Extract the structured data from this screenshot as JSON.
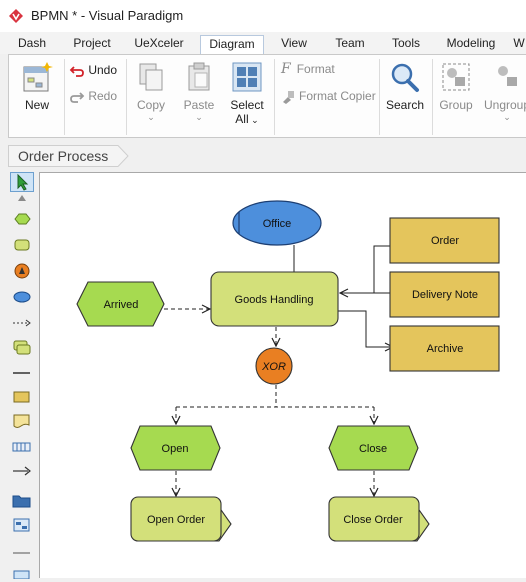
{
  "app": {
    "title": "BPMN * - Visual Paradigm"
  },
  "tabs": [
    {
      "label": "Dash"
    },
    {
      "label": "Project"
    },
    {
      "label": "UeXceler"
    },
    {
      "label": "Diagram",
      "active": true
    },
    {
      "label": "View"
    },
    {
      "label": "Team"
    },
    {
      "label": "Tools"
    },
    {
      "label": "Modeling"
    },
    {
      "label": "W"
    }
  ],
  "ribbon": {
    "new": "New",
    "undo": "Undo",
    "redo": "Redo",
    "copy": "Copy",
    "paste": "Paste",
    "select_all_line1": "Select",
    "select_all_line2": "All",
    "format": "Format",
    "format_copier": "Format Copier",
    "search": "Search",
    "group": "Group",
    "ungroup": "Ungroup"
  },
  "breadcrumb": {
    "label": "Order Process"
  },
  "toolbox": [
    "pointer-tool",
    "scroll-up-arrow",
    "event-tool",
    "task-tool",
    "gateway-tool",
    "data-object-tool",
    "connector-tool",
    "subprocess-tool",
    "line-tool",
    "note-tool",
    "document-tool",
    "pool-tool",
    "flow-arrow-tool",
    "folder-tool",
    "form-tool",
    "divider-tool"
  ],
  "diagram": {
    "office": "Office",
    "goods_handling": "Goods Handling",
    "arrived": "Arrived",
    "order": "Order",
    "delivery_note": "Delivery Note",
    "archive": "Archive",
    "xor": "XOR",
    "open": "Open",
    "close": "Close",
    "open_order": "Open Order",
    "close_order": "Close Order"
  },
  "colors": {
    "accent": "#b8c9de",
    "function_fill": "#d3e07a",
    "event_fill": "#a6da50",
    "info_fill": "#e4c55c",
    "org_fill": "#4d8fdc",
    "xor_fill": "#e97f22",
    "logo": "#d9333f"
  }
}
